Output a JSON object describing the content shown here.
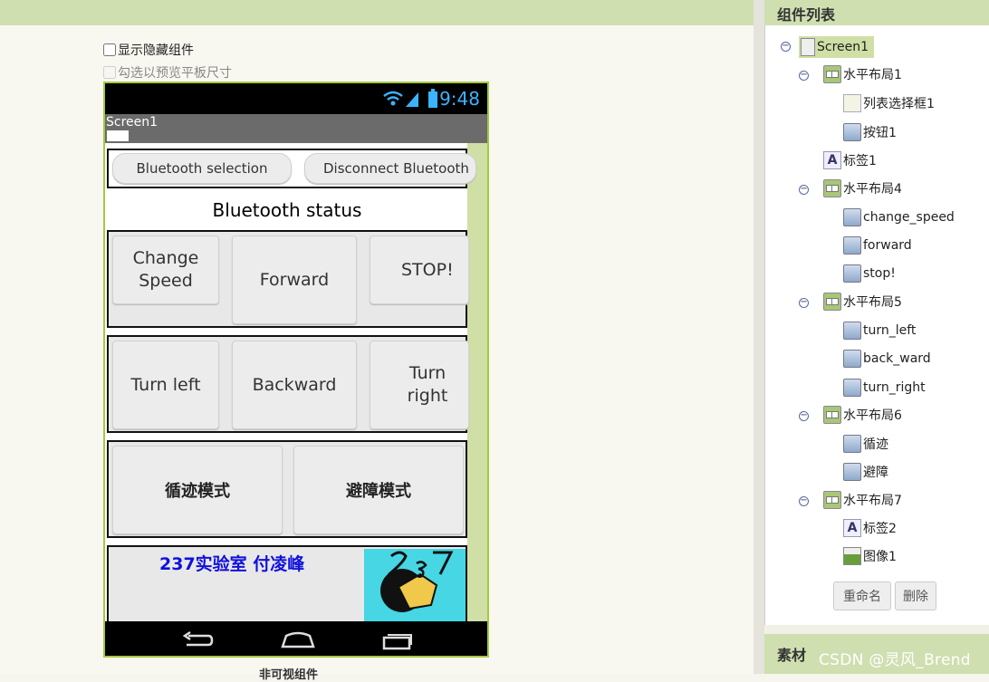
{
  "viewer": {
    "show_hidden_label": "显示隐藏组件",
    "tablet_preview_label": "勾选以预览平板尺寸",
    "below_caption": "非可视组件"
  },
  "phone": {
    "time": "9:48",
    "screen_title": "Screen1",
    "bt_selection": "Bluetooth selection",
    "bt_disconnect": "Disconnect Bluetooth",
    "bt_status": "Bluetooth status",
    "change_speed": "Change Speed",
    "forward": "Forward",
    "stop": "STOP!",
    "turn_left": "Turn left",
    "backward": "Backward",
    "turn_right": "Turn right",
    "line_mode": "循迹模式",
    "avoid_mode": "避障模式",
    "lab_label": "237实验室 付凌峰",
    "lab_label_color": "#1010dd",
    "logo_bg_color": "#46d6e4"
  },
  "components": {
    "header": "组件列表",
    "tree": [
      {
        "label": "Screen1",
        "icon": "screen-icon"
      },
      {
        "label": "水平布局1",
        "icon": "layout-icon"
      },
      {
        "label": "列表选择框1",
        "icon": "listpicker-icon"
      },
      {
        "label": "按钮1",
        "icon": "button-icon"
      },
      {
        "label": "标签1",
        "icon": "label-icon"
      },
      {
        "label": "水平布局4",
        "icon": "layout-icon"
      },
      {
        "label": "change_speed",
        "icon": "button-icon"
      },
      {
        "label": "forward",
        "icon": "button-icon"
      },
      {
        "label": "stop!",
        "icon": "button-icon"
      },
      {
        "label": "水平布局5",
        "icon": "layout-icon"
      },
      {
        "label": "turn_left",
        "icon": "button-icon"
      },
      {
        "label": "back_ward",
        "icon": "button-icon"
      },
      {
        "label": "turn_right",
        "icon": "button-icon"
      },
      {
        "label": "水平布局6",
        "icon": "layout-icon"
      },
      {
        "label": "循迹",
        "icon": "button-icon"
      },
      {
        "label": "避障",
        "icon": "button-icon"
      },
      {
        "label": "水平布局7",
        "icon": "layout-icon"
      },
      {
        "label": "标签2",
        "icon": "label-icon"
      },
      {
        "label": "图像1",
        "icon": "image-icon"
      }
    ],
    "rename_label": "重命名",
    "delete_label": "删除"
  },
  "media": {
    "header": "素材"
  },
  "watermark": "CSDN @灵风_Brend"
}
